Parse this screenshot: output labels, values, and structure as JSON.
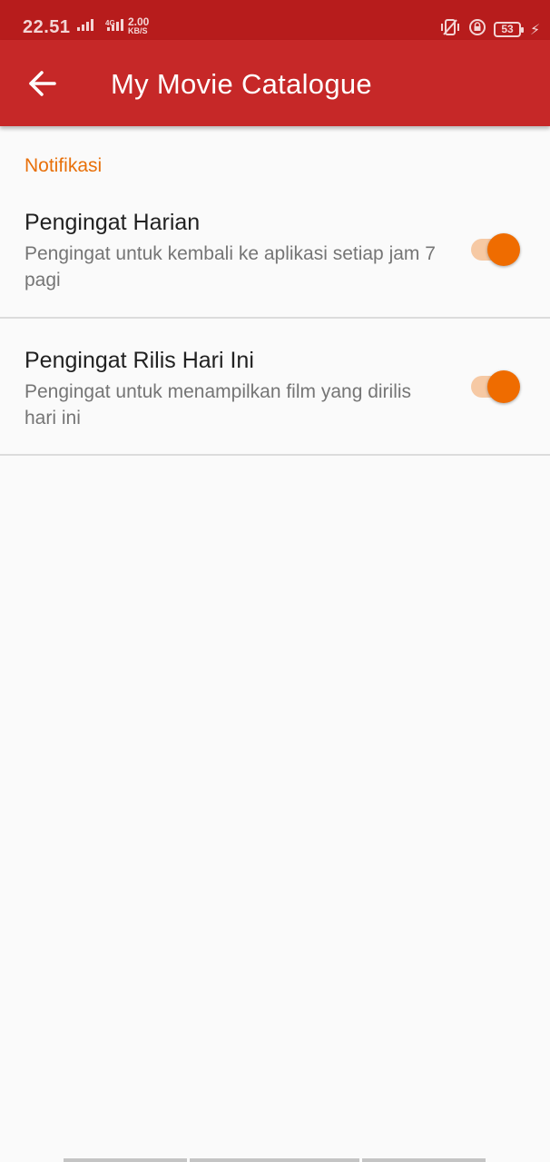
{
  "status_bar": {
    "time": "22.51",
    "network_type": "4G",
    "speed_value": "2.00",
    "speed_unit": "KB/S",
    "battery_level": "53"
  },
  "app_bar": {
    "title": "My Movie Catalogue",
    "back_icon": "arrow-left-icon"
  },
  "category": {
    "title": "Notifikasi"
  },
  "preferences": [
    {
      "title": "Pengingat Harian",
      "summary": "Pengingat untuk kembali ke aplikasi setiap jam 7 pagi",
      "enabled": true
    },
    {
      "title": "Pengingat Rilis Hari Ini",
      "summary": "Pengingat untuk menampilkan film yang dirilis hari ini",
      "enabled": true
    }
  ],
  "colors": {
    "status_bar": "#b71c1c",
    "app_bar": "#c62828",
    "accent": "#ef6c00",
    "switch_track": "#f6c9a4",
    "background": "#fafafa"
  }
}
